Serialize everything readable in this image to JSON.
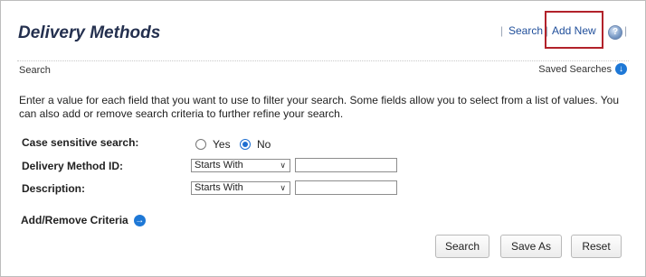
{
  "header": {
    "title": "Delivery Methods",
    "links": {
      "search": "Search",
      "add_new": "Add New"
    },
    "help_icon": "?"
  },
  "search_bar": {
    "label": "Search",
    "saved_searches": "Saved Searches"
  },
  "instructions": "Enter a value for each field that you want to use to filter your search. Some fields allow you to select from a list of values. You can also add or remove search criteria to further refine your search.",
  "form": {
    "case_sensitive": {
      "label": "Case sensitive search:",
      "options": [
        "Yes",
        "No"
      ],
      "selected": "No"
    },
    "fields": [
      {
        "label": "Delivery Method ID:",
        "operator": "Starts With",
        "value": ""
      },
      {
        "label": "Description:",
        "operator": "Starts With",
        "value": ""
      }
    ],
    "add_remove_criteria": "Add/Remove Criteria"
  },
  "buttons": {
    "search": "Search",
    "save_as": "Save As",
    "reset": "Reset"
  },
  "icons": {
    "help": "help-icon",
    "saved_searches": "circle-arrow-down-icon",
    "add_remove_criteria": "circle-arrow-right-icon"
  },
  "colors": {
    "title": "#24304f",
    "link": "#1f4e9a",
    "highlight_border": "#b2222a",
    "radio_accent": "#1f6fd1"
  }
}
